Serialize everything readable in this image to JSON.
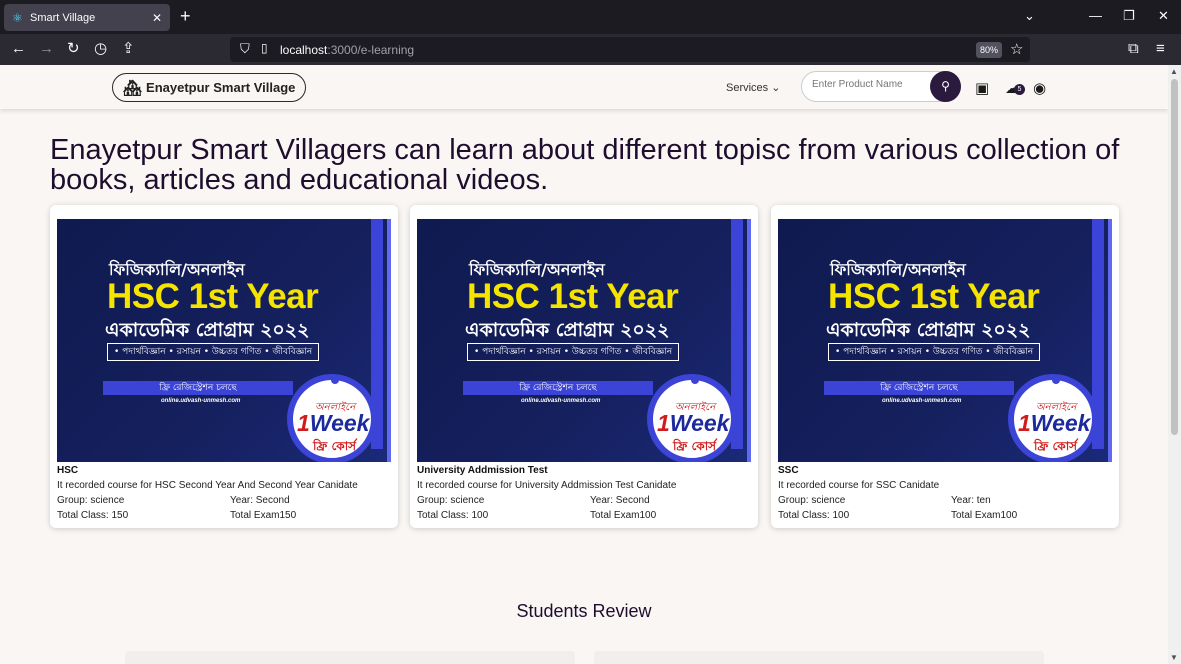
{
  "browser": {
    "tab_title": "Smart Village",
    "url_host": "localhost",
    "url_path": ":3000/e-learning",
    "zoom": "80%"
  },
  "header": {
    "brand": "Enayetpur Smart Village",
    "services_label": "Services",
    "search_placeholder": "Enter Product Name",
    "cart_count": "5"
  },
  "hero_text": "Enayetpur Smart Villagers can learn about different topisc from various collection of books, articles and educational videos.",
  "poster": {
    "top_line": "ফিজিক্যালি/অনলাইন",
    "headline": "HSC 1st Year",
    "program": "একাডেমিক প্রোগ্রাম ২০২২",
    "subjects": "• পদার্থবিজ্ঞান • রসায়ন • উচ্চতর গণিত • জীববিজ্ঞান",
    "registration": "ফ্রি রেজিস্ট্রেশন চলছে",
    "website": "online.udvash-unmesh.com",
    "badge_top": "অনলাইনে",
    "badge_one": "1",
    "badge_week": "Week",
    "badge_bottom": "ফ্রি কোর্স"
  },
  "courses": [
    {
      "title": "HSC",
      "description": "It recorded course for HSC Second Year And Second Year Canidate",
      "group": "Group: science",
      "year": "Year: Second",
      "total_class": "Total Class: 150",
      "total_exam": "Total Exam150"
    },
    {
      "title": "University Addmission Test",
      "description": "It recorded course for University Addmission Test Canidate",
      "group": "Group: science",
      "year": "Year: Second",
      "total_class": "Total Class: 100",
      "total_exam": "Total Exam100"
    },
    {
      "title": "SSC",
      "description": "It recorded course for SSC Canidate",
      "group": "Group: science",
      "year": "Year: ten",
      "total_class": "Total Class: 100",
      "total_exam": "Total Exam100"
    }
  ],
  "reviews_heading": "Students Review"
}
